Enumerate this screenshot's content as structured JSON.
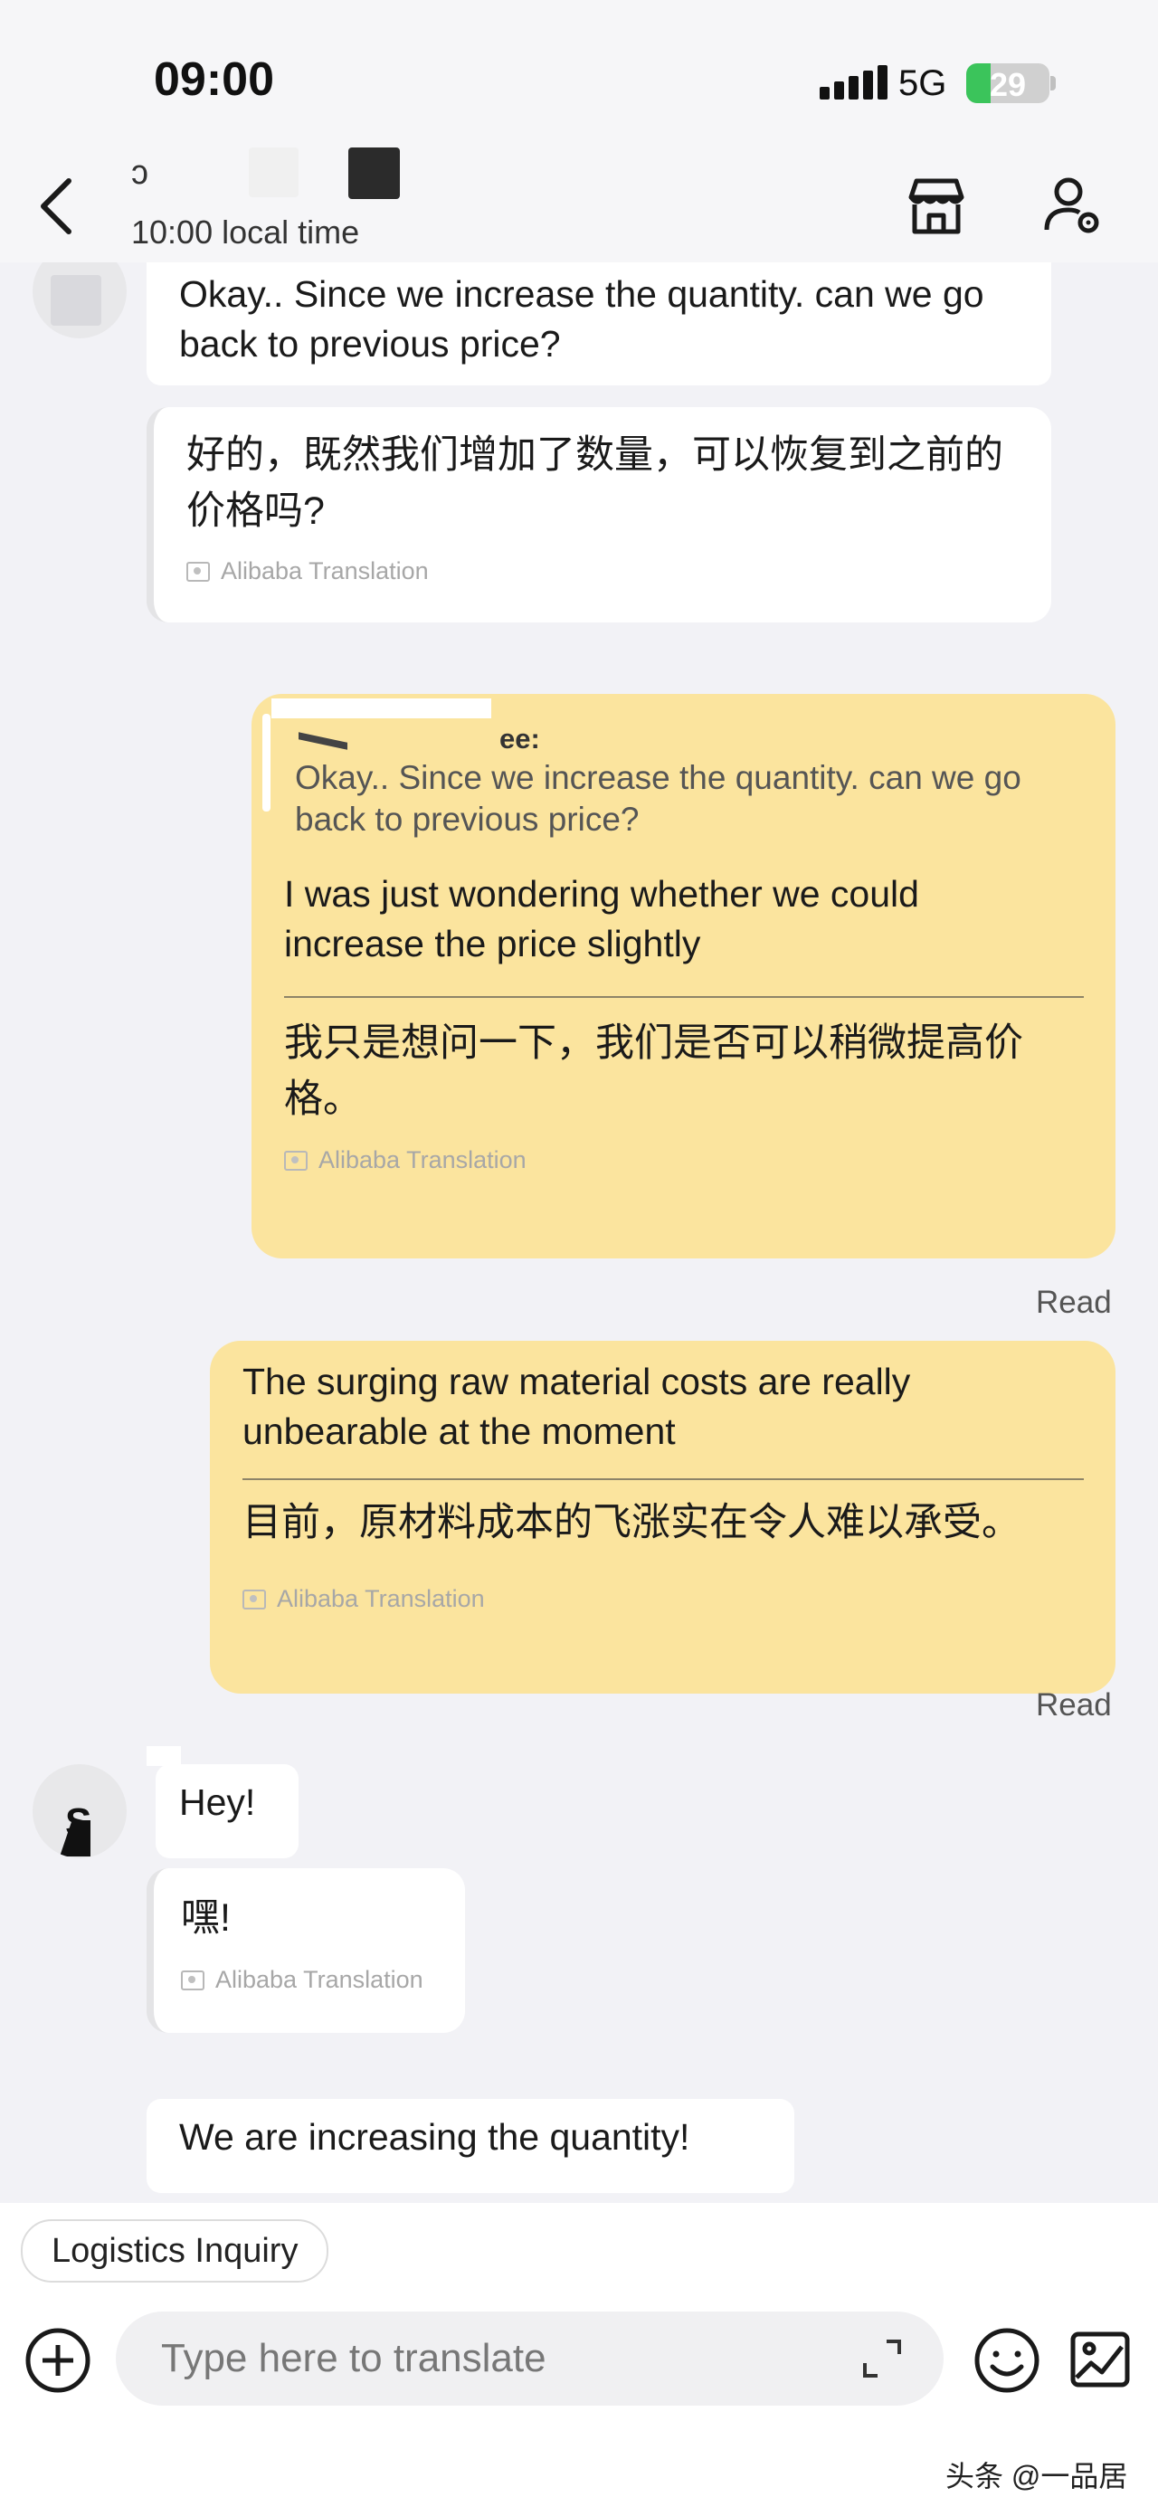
{
  "status_bar": {
    "time": "09:00",
    "network": "5G",
    "battery": "29",
    "battery_level": 0.29
  },
  "header": {
    "contact_name": "ɔ",
    "local_time": "10:00 local time",
    "icons": {
      "back": "chevron-left-icon",
      "store": "store-icon",
      "profile": "profile-settings-icon"
    }
  },
  "messages": {
    "m1": {
      "text": "Okay.. Since we increase the quantity. can we go back to previous price?",
      "translation": "好的，既然我们增加了数量，可以恢复到之前的价格吗?",
      "translation_label": "Alibaba Translation"
    },
    "m2": {
      "quote_author": "ee:",
      "quote_text": "Okay.. Since we increase the quantity. can we go back to previous price?",
      "text": "I was just wondering whether we could increase the price slightly",
      "translation": "我只是想问一下，我们是否可以稍微提高价格。",
      "translation_label": "Alibaba Translation",
      "status": "Read"
    },
    "m3": {
      "text": "The surging raw material costs are really unbearable at the moment",
      "translation": "目前，原材料成本的飞涨实在令人难以承受。",
      "translation_label": "Alibaba Translation",
      "status": "Read"
    },
    "m4": {
      "avatar_letter": "S",
      "text": "Hey!",
      "translation": "嘿!",
      "translation_label": "Alibaba Translation"
    },
    "m5": {
      "text": "We are increasing the quantity!"
    }
  },
  "quick_reply": {
    "chip": "Logistics Inquiry"
  },
  "composer": {
    "placeholder": "Type here to translate",
    "icons": {
      "add": "plus-circle-icon",
      "expand": "expand-icon",
      "emoji": "emoji-icon",
      "photo": "photo-icon"
    }
  },
  "watermark": "头条 @一品居",
  "colors": {
    "outgoing_bubble": "#fbe49e",
    "incoming_bubble": "#ffffff",
    "chat_background": "#f2f2f6",
    "battery_green": "#3bc45b"
  }
}
